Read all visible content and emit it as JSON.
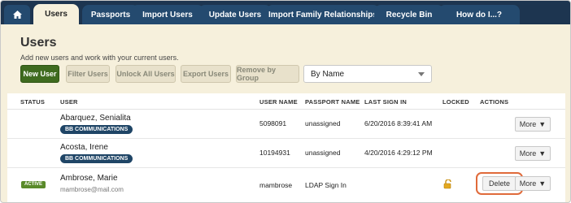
{
  "tabs": [
    {
      "label": "Users",
      "active": true
    },
    {
      "label": "Passports",
      "active": false
    },
    {
      "label": "Import Users",
      "active": false
    },
    {
      "label": "Update Users",
      "active": false
    },
    {
      "label": "Import Family Relationships",
      "active": false
    },
    {
      "label": "Recycle Bin",
      "active": false
    },
    {
      "label": "How do I...?",
      "active": false
    }
  ],
  "home_icon": "home-icon",
  "page": {
    "title": "Users",
    "subtitle": "Add new users and work with your current users."
  },
  "toolbar": {
    "new_user": "New User",
    "filter_users": "Filter Users",
    "unlock_all": "Unlock All Users",
    "export_users": "Export Users",
    "remove_by_group": "Remove by Group",
    "sort_select": "By Name"
  },
  "table": {
    "headers": [
      "STATUS",
      "USER",
      "USER NAME",
      "PASSPORT NAME",
      "LAST SIGN IN",
      "LOCKED",
      "ACTIONS"
    ],
    "rows": [
      {
        "status": "",
        "name": "Abarquez, Senialita",
        "tag": "BB COMMUNICATIONS",
        "email": "",
        "username": "5098091",
        "passport": "unassigned",
        "last_sign_in": "6/20/2016 8:39:41 AM",
        "locked": false,
        "more": "More"
      },
      {
        "status": "",
        "name": "Acosta, Irene",
        "tag": "BB COMMUNICATIONS",
        "email": "",
        "username": "10194931",
        "passport": "unassigned",
        "last_sign_in": "4/20/2016 4:29:12 PM",
        "locked": false,
        "more": "More"
      },
      {
        "status": "ACTIVE",
        "name": "Ambrose, Marie",
        "tag": "",
        "email": "mambrose@mail.com",
        "username": "mambrose",
        "passport": "LDAP Sign In",
        "last_sign_in": "",
        "locked": true,
        "delete": "Delete",
        "more": "More"
      }
    ]
  },
  "colors": {
    "tabbar": "#1d3550",
    "tab": "#244a6f",
    "panel": "#f6f0dc",
    "primary_button": "#3f6b1f",
    "tag": "#1f4566",
    "active_badge": "#5a8a2a",
    "highlight": "#e06a3a"
  }
}
